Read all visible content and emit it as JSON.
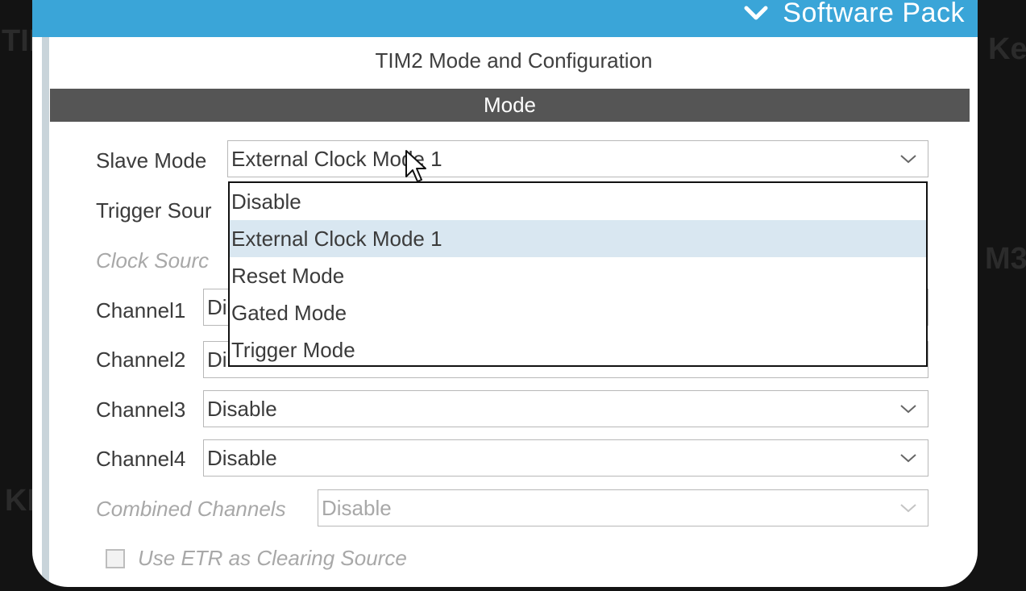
{
  "header": {
    "software_packs_label": "Software Pack"
  },
  "panel": {
    "title": "TIM2 Mode and Configuration",
    "section_header": "Mode"
  },
  "slave_mode": {
    "label": "Slave Mode",
    "value": "External Clock Mode 1"
  },
  "dropdown": {
    "options": [
      "Disable",
      "External Clock Mode 1",
      "Reset Mode",
      "Gated Mode",
      "Trigger Mode"
    ],
    "selected_index": 1
  },
  "trigger_source": {
    "label": "Trigger Sour"
  },
  "clock_source": {
    "label": "Clock Sourc"
  },
  "channel1": {
    "label": "Channel1",
    "value": "Di"
  },
  "channel2": {
    "label": "Channel2",
    "value": "Di"
  },
  "channel3": {
    "label": "Channel3",
    "value": "Disable"
  },
  "channel4": {
    "label": "Channel4",
    "value": "Disable"
  },
  "combined_channels": {
    "label": "Combined Channels",
    "value": "Disable"
  },
  "etr": {
    "label": "Use ETR as Clearing Source",
    "checked": false
  },
  "colors": {
    "topbar": "#3aa5d8",
    "section_header": "#555555",
    "selected_option": "#d9e7f1"
  }
}
